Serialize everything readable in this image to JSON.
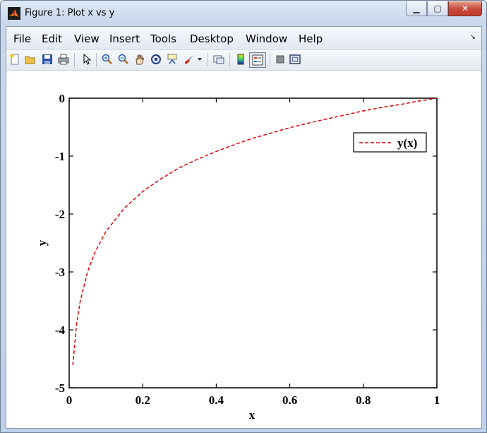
{
  "window": {
    "title": "Figure 1: Plot x vs y",
    "buttons": {
      "minimize": "▁",
      "maximize": "▢",
      "close": "✕"
    }
  },
  "menubar": {
    "items": [
      "File",
      "Edit",
      "View",
      "Insert",
      "Tools",
      "Desktop",
      "Window",
      "Help"
    ],
    "corner_icon": "dock-arrow-icon",
    "corner_glyph": "↘"
  },
  "toolbar": {
    "icons": [
      "new-figure-icon",
      "open-file-icon",
      "save-icon",
      "print-icon",
      "pointer-icon",
      "zoom-in-icon",
      "zoom-out-icon",
      "pan-hand-icon",
      "rotate-3d-icon",
      "data-cursor-icon",
      "brush-icon",
      "link-plot-icon",
      "colorbar-icon",
      "legend-icon",
      "hide-plot-tools-icon",
      "show-plot-tools-icon"
    ]
  },
  "colors": {
    "series": "#e00000",
    "axes": "#000000"
  },
  "chart_data": {
    "type": "line",
    "title": "",
    "xlabel": "x",
    "ylabel": "y",
    "xlim": [
      0,
      1
    ],
    "ylim": [
      -5,
      0
    ],
    "xticks": [
      "0",
      "0.2",
      "0.4",
      "0.6",
      "0.8",
      "1"
    ],
    "yticks": [
      "0",
      "-1",
      "-2",
      "-3",
      "-4",
      "-5"
    ],
    "legend_position": "top-right",
    "grid": false,
    "series": [
      {
        "name": "y(x)",
        "line_style": "dashed",
        "color": "#e00000",
        "x": [
          0.01,
          0.02,
          0.03,
          0.05,
          0.07,
          0.1,
          0.15,
          0.2,
          0.25,
          0.3,
          0.35,
          0.4,
          0.45,
          0.5,
          0.55,
          0.6,
          0.65,
          0.7,
          0.75,
          0.8,
          0.85,
          0.9,
          0.95,
          1.0
        ],
        "y": [
          -4.61,
          -3.91,
          -3.51,
          -3.0,
          -2.66,
          -2.3,
          -1.9,
          -1.61,
          -1.39,
          -1.2,
          -1.05,
          -0.92,
          -0.8,
          -0.69,
          -0.6,
          -0.51,
          -0.43,
          -0.36,
          -0.29,
          -0.22,
          -0.16,
          -0.11,
          -0.05,
          0.0
        ]
      }
    ]
  }
}
